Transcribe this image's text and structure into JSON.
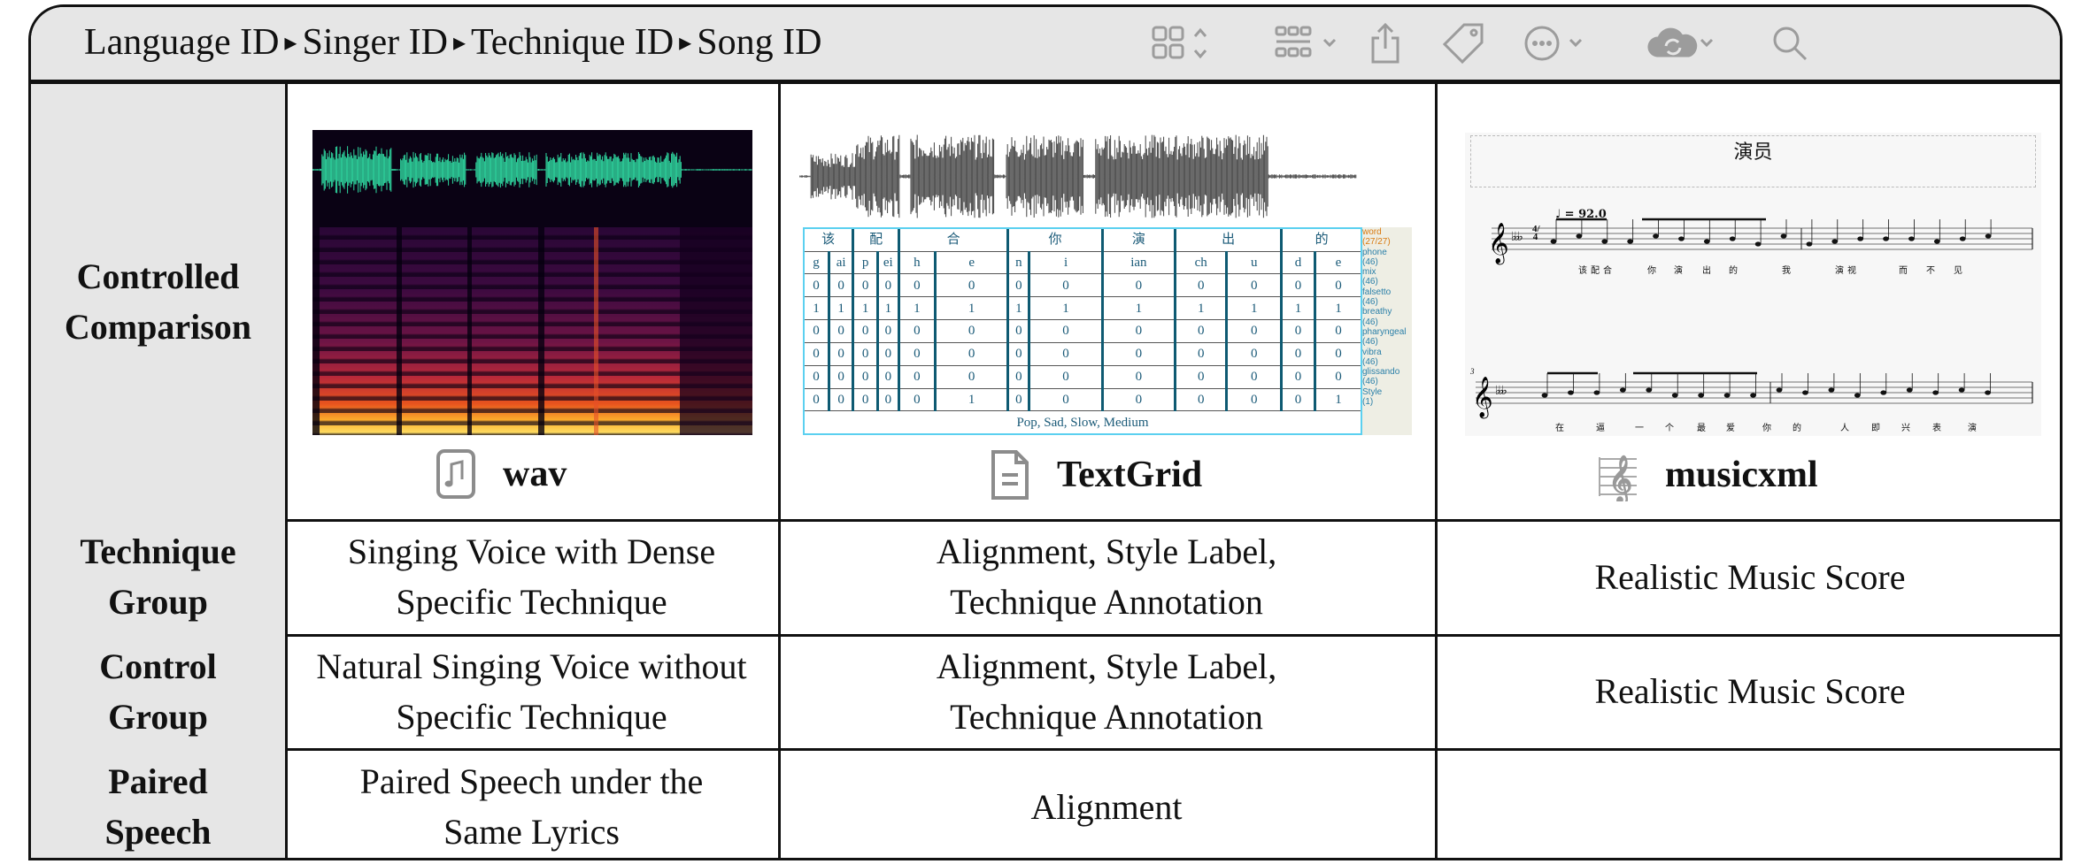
{
  "titlebar": {
    "breadcrumb": [
      "Language ID",
      "Singer ID",
      "Technique ID",
      "Song ID"
    ],
    "breadcrumb_separator": "▸",
    "toolbar_icons": [
      "grid-view-icon",
      "group-by-icon",
      "share-icon",
      "tag-icon",
      "more-icon",
      "cloud-sync-icon",
      "search-icon"
    ]
  },
  "table": {
    "row_headers": [
      "Controlled Comparison",
      "Technique Group",
      "Control Group",
      "Paired Speech"
    ],
    "formats": [
      {
        "label": "wav",
        "icon": "audio-file-icon"
      },
      {
        "label": "TextGrid",
        "icon": "document-icon"
      },
      {
        "label": "musicxml",
        "icon": "treble-clef-icon"
      }
    ],
    "rows": [
      {
        "header": "Technique Group",
        "wav": "Singing Voice with Dense Specific Technique",
        "textgrid": "Alignment, Style Label, Technique Annotation",
        "musicxml": "Realistic Music Score"
      },
      {
        "header": "Control Group",
        "wav": "Natural Singing Voice without Specific Technique",
        "textgrid": "Alignment, Style Label, Technique Annotation",
        "musicxml": "Realistic Music Score"
      },
      {
        "header": "Paired Speech",
        "wav": "Paired Speech under the Same Lyrics",
        "textgrid": "Alignment",
        "musicxml": ""
      }
    ]
  },
  "textgrid": {
    "words": [
      {
        "text": "该",
        "span": 2
      },
      {
        "text": "配",
        "span": 2
      },
      {
        "text": "合",
        "span": 2
      },
      {
        "text": "你",
        "span": 2
      },
      {
        "text": "演",
        "span": 1
      },
      {
        "text": "出",
        "span": 2
      },
      {
        "text": "的",
        "span": 2
      }
    ],
    "phones": [
      "g",
      "ai",
      "p",
      "ei",
      "h",
      "e",
      "n",
      "i",
      "ian",
      "ch",
      "u",
      "d",
      "e"
    ],
    "technique_rows": [
      [
        0,
        0,
        0,
        0,
        0,
        0,
        0,
        0,
        0,
        0,
        0,
        0,
        0
      ],
      [
        1,
        1,
        1,
        1,
        1,
        1,
        1,
        1,
        1,
        1,
        1,
        1,
        1
      ],
      [
        0,
        0,
        0,
        0,
        0,
        0,
        0,
        0,
        0,
        0,
        0,
        0,
        0
      ],
      [
        0,
        0,
        0,
        0,
        0,
        0,
        0,
        0,
        0,
        0,
        0,
        0,
        0
      ],
      [
        0,
        0,
        0,
        0,
        0,
        0,
        0,
        0,
        0,
        0,
        0,
        0,
        0
      ],
      [
        0,
        0,
        0,
        0,
        0,
        1,
        0,
        0,
        0,
        0,
        0,
        0,
        1
      ]
    ],
    "style": "Pop, Sad, Slow, Medium",
    "tiers": [
      {
        "name": "word",
        "count": "(27/27)"
      },
      {
        "name": "phone",
        "count": "(46)"
      },
      {
        "name": "mix",
        "count": "(46)"
      },
      {
        "name": "falsetto",
        "count": "(46)"
      },
      {
        "name": "breathy",
        "count": "(46)"
      },
      {
        "name": "pharyngeal",
        "count": "(46)"
      },
      {
        "name": "vibra",
        "count": "(46)"
      },
      {
        "name": "glissando",
        "count": "(46)"
      },
      {
        "name": "Style",
        "count": "(1)"
      }
    ]
  },
  "score": {
    "title": "演员",
    "tempo": "♩ = 92.0",
    "key": "A♭ major (4 flats)",
    "time_signature": "4/4",
    "measure_number": "3",
    "lyrics_line1": [
      "该",
      "配",
      "合",
      "你",
      "演",
      "出",
      "的",
      "我",
      "演",
      "视",
      "而",
      "不",
      "见"
    ],
    "lyrics_line2": [
      "在",
      "逼",
      "一",
      "个",
      "最",
      "爱",
      "你",
      "的",
      "人",
      "即",
      "兴",
      "表",
      "演"
    ]
  },
  "colors": {
    "header_bg": "#e6e6e6",
    "icon_gray": "#9c9c9c",
    "textgrid_text": "#1a5a78",
    "textgrid_border": "#5bd0f0",
    "waveform_green": "#2fd9a0",
    "tier_orange": "#d97a10"
  }
}
